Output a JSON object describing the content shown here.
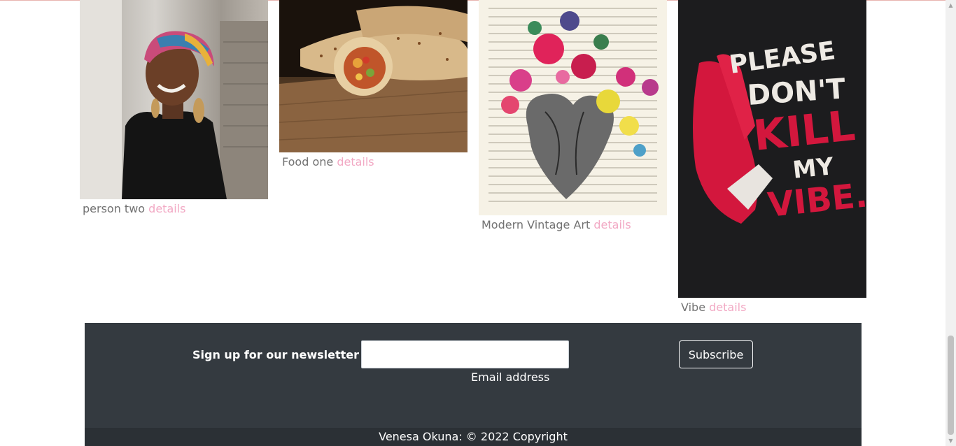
{
  "gallery": {
    "items": [
      {
        "title": "person two",
        "link": "details"
      },
      {
        "title": "Food one",
        "link": "details"
      },
      {
        "title": "Modern Vintage Art",
        "link": "details"
      },
      {
        "title": "Vibe",
        "link": "details"
      }
    ]
  },
  "vibe_art": {
    "line1": "PLEASE",
    "line2": "DON'T",
    "line3": "KILL",
    "line4": "MY",
    "line5": "VIBE."
  },
  "newsletter": {
    "label": "Sign up for our newsletter",
    "email_value": "",
    "email_help": "Email address",
    "button_label": "Subscribe"
  },
  "footer": {
    "copyright": "Venesa Okuna: © 2022 Copyright"
  },
  "colors": {
    "link": "#f2a9c4",
    "footer_bg": "#343a40",
    "copyright_bg": "#2b3035"
  }
}
